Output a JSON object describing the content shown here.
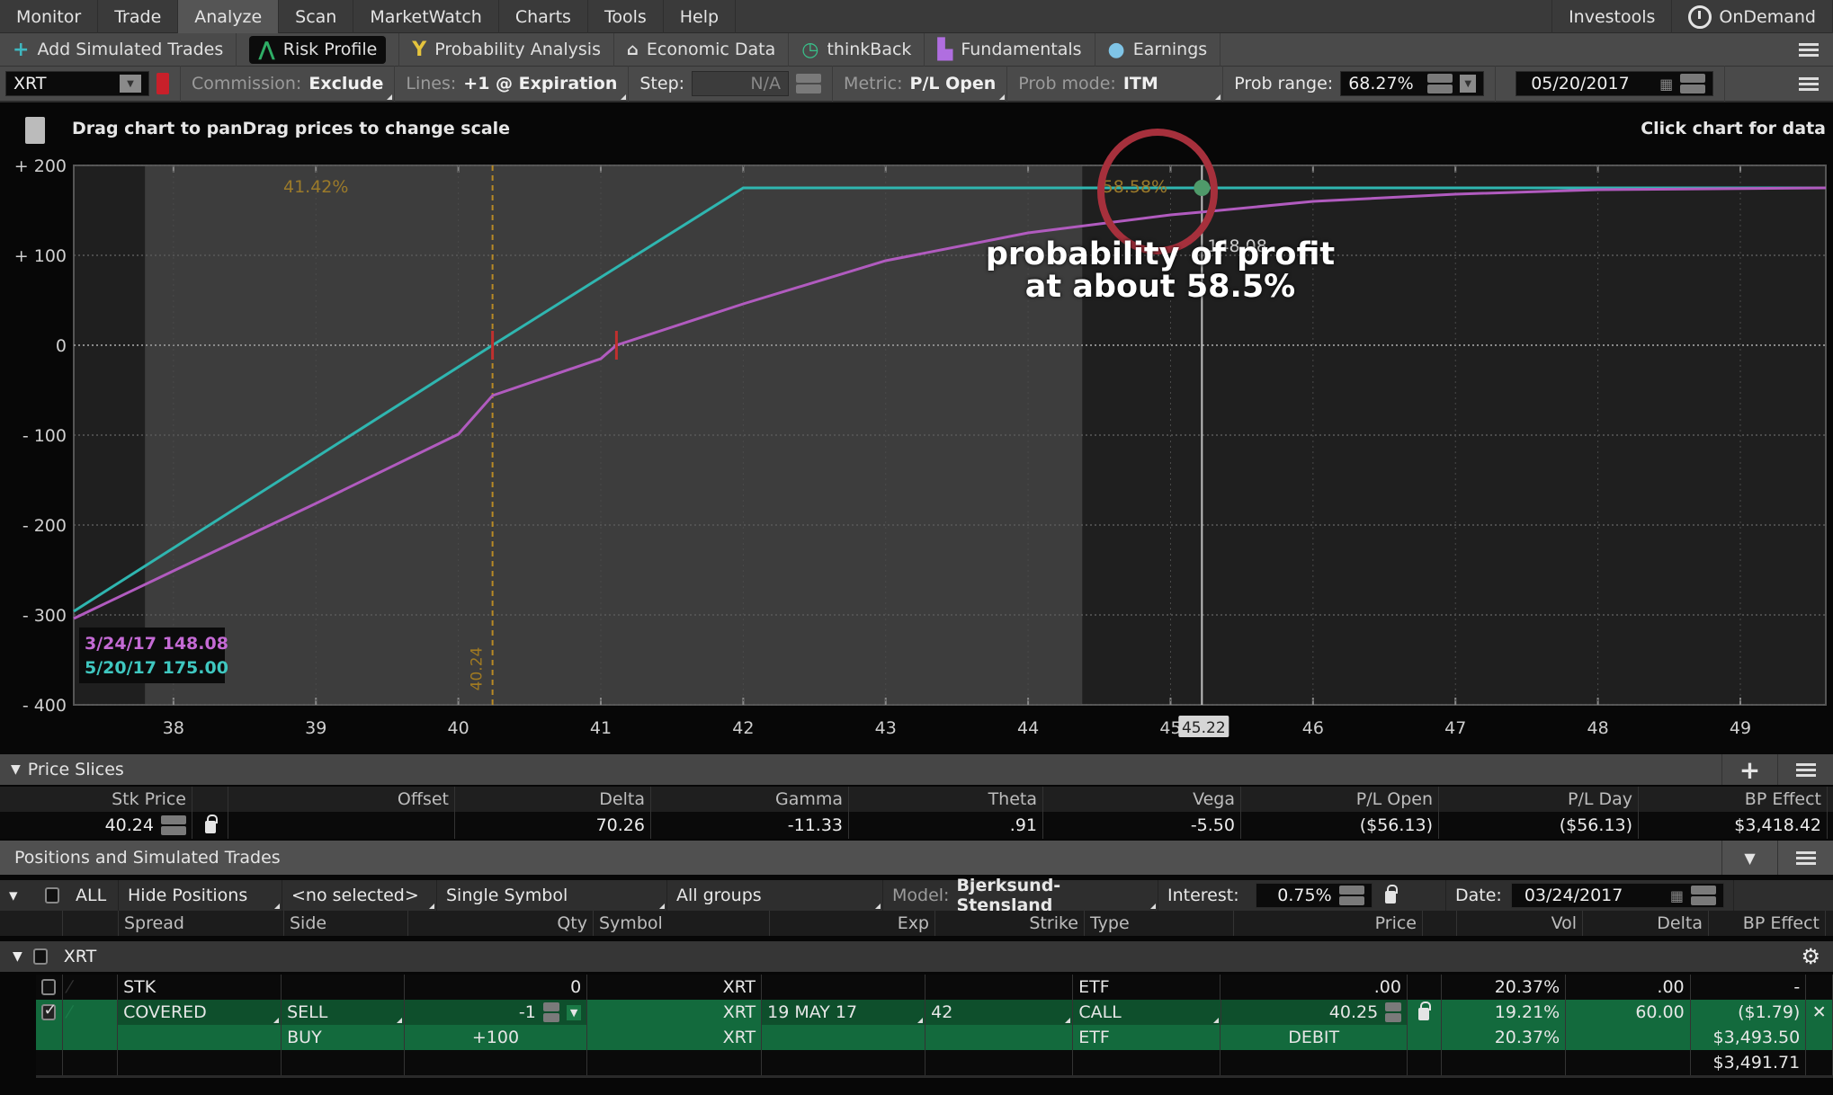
{
  "menubar": {
    "items": [
      {
        "label": "Monitor",
        "active": false
      },
      {
        "label": "Trade",
        "active": false
      },
      {
        "label": "Analyze",
        "active": true
      },
      {
        "label": "Scan",
        "active": false
      },
      {
        "label": "MarketWatch",
        "active": false
      },
      {
        "label": "Charts",
        "active": false
      },
      {
        "label": "Tools",
        "active": false
      },
      {
        "label": "Help",
        "active": false
      }
    ],
    "right": {
      "investools": "Investools",
      "ondemand": "OnDemand"
    }
  },
  "toolbar": {
    "items": [
      {
        "label": "Add Simulated Trades",
        "icon": "plus-icon",
        "glyph": "+",
        "color": "#3fb7c0"
      },
      {
        "label": "Risk Profile",
        "icon": "risk-profile-icon",
        "glyph": "⋀",
        "color": "#2fae66",
        "selected": true
      },
      {
        "label": "Probability Analysis",
        "icon": "probability-icon",
        "glyph": "Y",
        "color": "#e5c43d"
      },
      {
        "label": "Economic Data",
        "icon": "building-icon",
        "glyph": "🏛",
        "color": "#e0e0e0"
      },
      {
        "label": "thinkBack",
        "icon": "clock-back-icon",
        "glyph": "◷",
        "color": "#39c08a"
      },
      {
        "label": "Fundamentals",
        "icon": "fundamentals-icon",
        "glyph": "▞",
        "color": "#b06ee0"
      },
      {
        "label": "Earnings",
        "icon": "lightbulb-icon",
        "glyph": "💡",
        "color": "#7fc4e6"
      }
    ]
  },
  "options": {
    "symbol": "XRT",
    "commission_label": "Commission:",
    "commission_value": "Exclude",
    "lines_label": "Lines:",
    "lines_value": "+1 @ Expiration",
    "step_label": "Step:",
    "step_value": "N/A",
    "metric_label": "Metric:",
    "metric_value": "P/L Open",
    "prob_mode_label": "Prob mode:",
    "prob_mode_value": "ITM",
    "prob_range_label": "Prob range:",
    "prob_range_value": "68.27%",
    "date_value": "05/20/2017"
  },
  "chart_header": {
    "hint_left": "Drag chart to panDrag prices to change scale",
    "hint_right": "Click chart for data"
  },
  "chart_data": {
    "type": "line",
    "xlabel": "",
    "ylabel": "",
    "xlim": [
      37.3,
      49.6
    ],
    "ylim": [
      -400,
      200
    ],
    "x_ticks": [
      38,
      39,
      40,
      41,
      42,
      43,
      44,
      45,
      46,
      47,
      48,
      49
    ],
    "y_ticks": [
      {
        "v": 200,
        "label": "+ 200"
      },
      {
        "v": 100,
        "label": "+ 100"
      },
      {
        "v": 0,
        "label": "0"
      },
      {
        "v": -100,
        "label": "- 100"
      },
      {
        "v": -200,
        "label": "- 200"
      },
      {
        "v": -300,
        "label": "- 300"
      },
      {
        "v": -400,
        "label": "- 400"
      }
    ],
    "prob_range": [
      37.8,
      44.38
    ],
    "series": [
      {
        "name": "5/20/17",
        "color": "#2fb6b0",
        "x": [
          37.3,
          40.24,
          42.0,
          49.6
        ],
        "y": [
          -296,
          0,
          175,
          175
        ]
      },
      {
        "name": "3/24/17",
        "color": "#b15bbf",
        "x": [
          37.3,
          38.0,
          39.0,
          40.0,
          40.24,
          41.0,
          41.11,
          42.0,
          43.0,
          44.0,
          45.0,
          45.22,
          46.0,
          47.0,
          48.0,
          49.6
        ],
        "y": [
          -304,
          -251,
          -176,
          -99,
          -56,
          -15,
          0,
          46,
          94,
          125,
          145,
          148.08,
          160,
          168,
          173,
          175
        ]
      }
    ],
    "current_price": {
      "value": 40.24,
      "label": "40.24"
    },
    "breakevens": [
      40.24,
      41.11
    ],
    "crosshair": {
      "x": 45.22,
      "label": "45.22",
      "y_label": "148.08"
    },
    "prob_labels": [
      {
        "text": "41.42%",
        "x": 39.0
      },
      {
        "text": "58.58%",
        "x": 44.75
      }
    ],
    "legend": [
      {
        "text": "3/24/17 148.08",
        "color": "#c46ad4"
      },
      {
        "text": "5/20/17 175.00",
        "color": "#3fc7c0"
      }
    ],
    "legend_position": "bottom-left"
  },
  "annotation": {
    "line1": "probability of profit",
    "line2": "at about 58.5%"
  },
  "price_slices": {
    "title": "Price Slices",
    "headers": [
      "Stk Price",
      "",
      "Offset",
      "Delta",
      "Gamma",
      "Theta",
      "Vega",
      "P/L Open",
      "P/L Day",
      "BP Effect"
    ],
    "values": [
      "40.24",
      "",
      "",
      "70.26",
      "-11.33",
      ".91",
      "-5.50",
      "($56.13)",
      "($56.13)",
      "$3,418.42"
    ]
  },
  "positions": {
    "title": "Positions and Simulated Trades",
    "filters": {
      "all": "ALL",
      "hide": "Hide Positions",
      "selected": "<no selected>",
      "symbol_mode": "Single Symbol",
      "groups": "All groups",
      "model_label": "Model:",
      "model_value": "Bjerksund-Stensland",
      "interest_label": "Interest:",
      "interest_value": "0.75%",
      "date_label": "Date:",
      "date_value": "03/24/2017"
    },
    "headers": [
      "Spread",
      "Side",
      "Qty",
      "Symbol",
      "Exp",
      "Strike",
      "Type",
      "Price",
      "Vol",
      "Delta",
      "BP Effect"
    ],
    "group": "XRT",
    "rows": [
      {
        "checked": false,
        "spread": "STK",
        "side": "",
        "qty": "0",
        "symbol": "XRT",
        "exp": "",
        "strike": "",
        "type": "ETF",
        "price": ".00",
        "vol": "20.37%",
        "delta": ".00",
        "bp": "-"
      },
      {
        "checked": true,
        "spread": "COVERED",
        "side": "SELL",
        "qty": "-1",
        "symbol": "XRT",
        "exp": "19 MAY 17",
        "strike": "42",
        "type": "CALL",
        "price": "40.25",
        "vol": "19.21%",
        "delta": "60.00",
        "bp": "($1.79)"
      },
      {
        "checked": null,
        "spread": "",
        "side": "BUY",
        "qty": "+100",
        "symbol": "XRT",
        "exp": "",
        "strike": "",
        "type": "ETF",
        "price": "DEBIT",
        "vol": "20.37%",
        "delta": "",
        "bp": "$3,493.50"
      },
      {
        "checked": null,
        "spread": "",
        "side": "",
        "qty": "",
        "symbol": "",
        "exp": "",
        "strike": "",
        "type": "",
        "price": "",
        "vol": "",
        "delta": "",
        "bp": "$3,491.71"
      }
    ]
  }
}
